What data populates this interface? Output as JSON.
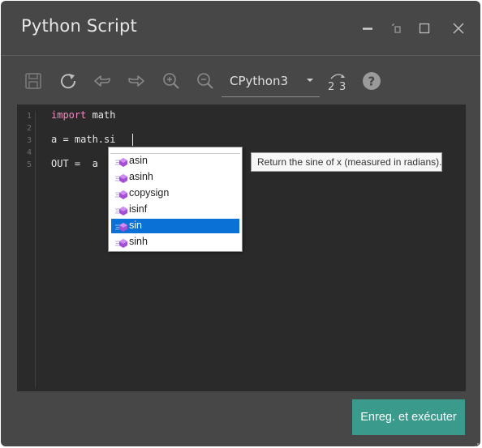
{
  "window": {
    "title": "Python Script"
  },
  "toolbar": {
    "icons": [
      "save-icon",
      "run-icon",
      "undo-icon",
      "redo-icon",
      "zoom-in-icon",
      "zoom-out-icon",
      "convert-2to3-icon",
      "help-icon"
    ],
    "engine": {
      "selected": "CPython3"
    }
  },
  "editor": {
    "line_numbers": [
      "1",
      "2",
      "3",
      "4",
      "5"
    ],
    "lines": {
      "l1_keyword": "import",
      "l1_rest": " math",
      "l3": "a = math.si",
      "l5": "OUT =  a"
    }
  },
  "autocomplete": {
    "items": [
      {
        "label": "asin"
      },
      {
        "label": "asinh"
      },
      {
        "label": "copysign"
      },
      {
        "label": "isinf"
      },
      {
        "label": "sin",
        "selected": true
      },
      {
        "label": "sinh"
      }
    ]
  },
  "tooltip": {
    "text": "Return the sine of x (measured in radians)."
  },
  "footer": {
    "run_label": "Enreg. et exécuter"
  },
  "colors": {
    "window_bg": "#474747",
    "editor_bg": "#2a2a2a",
    "accent": "#3a9a8c",
    "selection": "#0a72d6",
    "keyword": "#f08bbf"
  }
}
